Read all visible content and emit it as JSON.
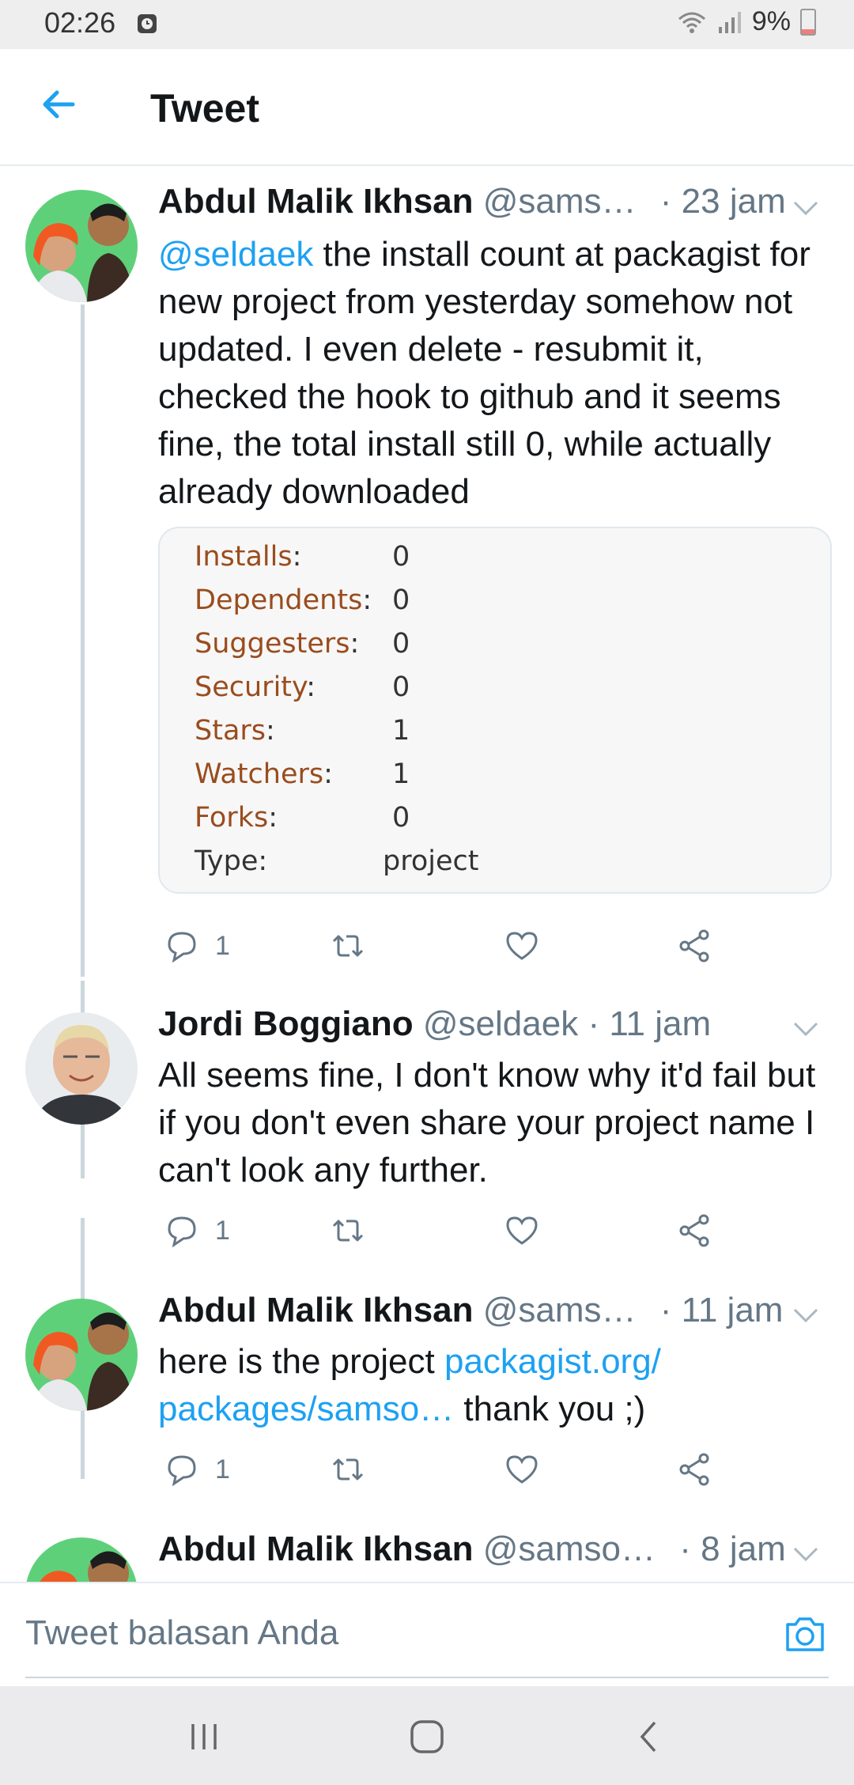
{
  "status_bar": {
    "time": "02:26",
    "battery": "9%"
  },
  "header": {
    "title": "Tweet"
  },
  "tweets": [
    {
      "name": "Abdul Malik Ikhsan",
      "handle": "@sams…",
      "time": "· 23 jam",
      "mention": "@seldaek",
      "text": " the install count at packagist for new project from yesterday somehow not updated. I even delete - resubmit it, checked the hook to github and it seems fine, the total install still 0, while actually already downloaded",
      "replies": "1"
    },
    {
      "name": "Jordi Boggiano",
      "handle": "@seldaek",
      "time": "· 11 jam",
      "text": "All seems fine, I don't know why it'd fail but if you don't even share your project name I can't look any further.",
      "replies": "1"
    },
    {
      "name": "Abdul Malik Ikhsan",
      "handle": "@sams…",
      "time": "· 11 jam",
      "text_before": "here is the project ",
      "link": "packagist.org/ packages/samso…",
      "text_after": " thank you ;)",
      "replies": "1"
    },
    {
      "name": "Abdul Malik Ikhsan",
      "handle": "@samso…",
      "time": "· 8 jam"
    }
  ],
  "media_stats": [
    {
      "label": "Installs",
      "value": "0"
    },
    {
      "label": "Dependents",
      "value": "0"
    },
    {
      "label": "Suggesters",
      "value": "0"
    },
    {
      "label": "Security",
      "value": "0"
    },
    {
      "label": "Stars",
      "value": "1"
    },
    {
      "label": "Watchers",
      "value": "1"
    },
    {
      "label": "Forks",
      "value": "0"
    },
    {
      "label": "Type:",
      "value": "project"
    }
  ],
  "reply_bar": {
    "placeholder": "Tweet balasan Anda"
  },
  "colors": {
    "accent": "#1da1f2",
    "label_brown": "#9a4c1e",
    "muted": "#657786"
  }
}
